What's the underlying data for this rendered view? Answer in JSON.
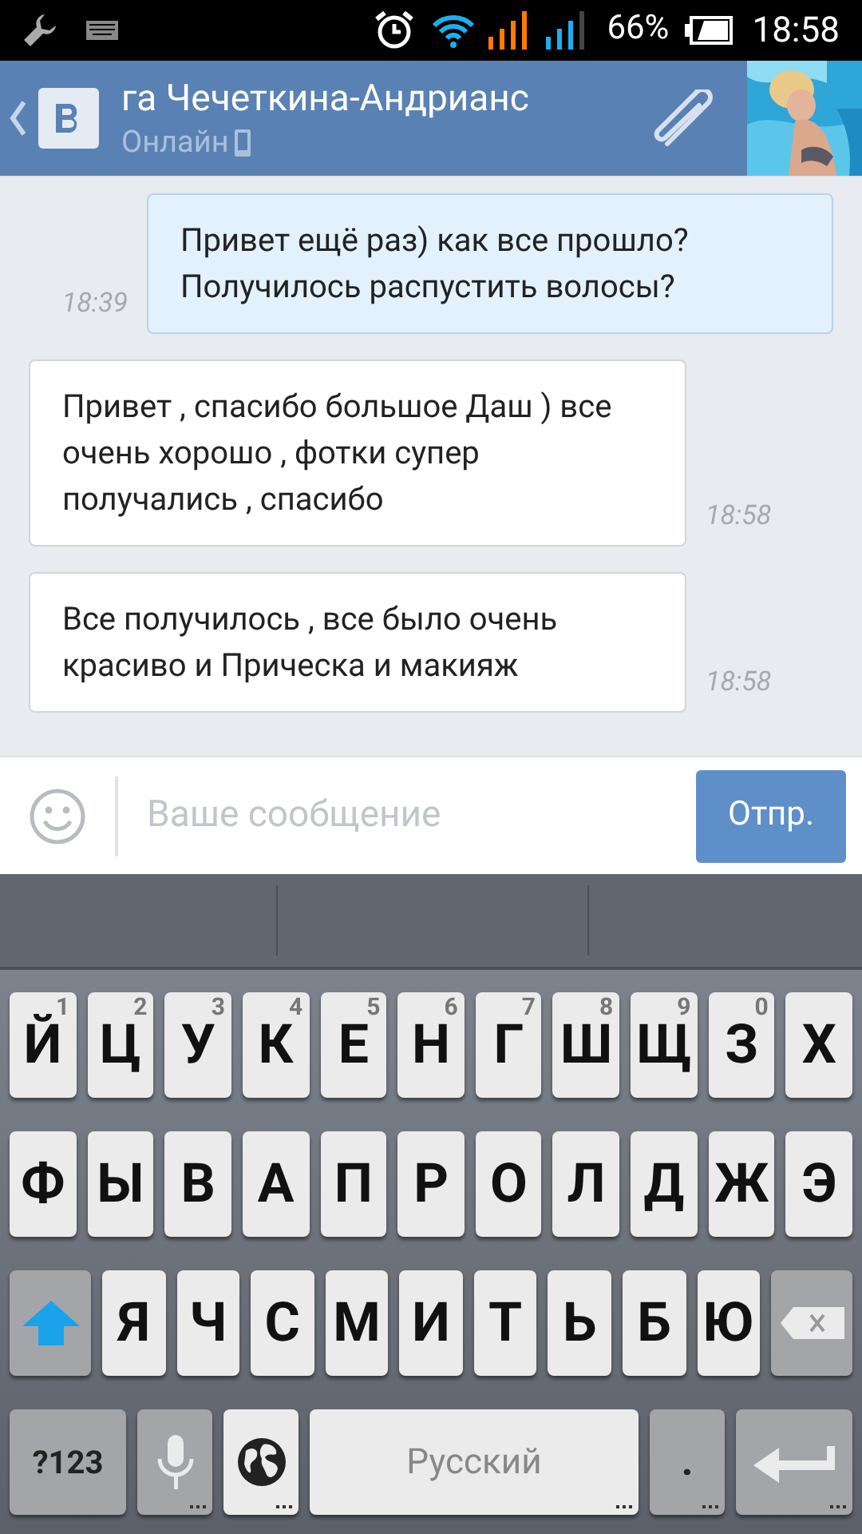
{
  "status_bar": {
    "battery": "66%",
    "time": "18:58"
  },
  "header": {
    "title": "га Чечеткина-Андрианс",
    "status": "Онлайн"
  },
  "messages": [
    {
      "kind": "outgoing",
      "text": "Привет ещё раз) как все прошло? Получилось распустить волосы?",
      "time": "18:39"
    },
    {
      "kind": "incoming",
      "text": "Привет , спасибо большое Даш ) все очень хорошо , фотки супер получались , спасибо",
      "time": "18:58"
    },
    {
      "kind": "incoming",
      "text": "Все получилось , все было очень красиво и Прическа и макияж",
      "time": "18:58"
    }
  ],
  "composer": {
    "placeholder": "Ваше сообщение",
    "send": "Отпр."
  },
  "keyboard": {
    "rows": [
      [
        {
          "kind": "letter",
          "label": "Й",
          "hint": "1"
        },
        {
          "kind": "letter",
          "label": "Ц",
          "hint": "2"
        },
        {
          "kind": "letter",
          "label": "У",
          "hint": "3"
        },
        {
          "kind": "letter",
          "label": "К",
          "hint": "4"
        },
        {
          "kind": "letter",
          "label": "Е",
          "hint": "5"
        },
        {
          "kind": "letter",
          "label": "Н",
          "hint": "6"
        },
        {
          "kind": "letter",
          "label": "Г",
          "hint": "7"
        },
        {
          "kind": "letter",
          "label": "Ш",
          "hint": "8"
        },
        {
          "kind": "letter",
          "label": "Щ",
          "hint": "9"
        },
        {
          "kind": "letter",
          "label": "З",
          "hint": "0"
        },
        {
          "kind": "letter",
          "label": "Х"
        }
      ],
      [
        {
          "kind": "letter",
          "label": "Ф"
        },
        {
          "kind": "letter",
          "label": "Ы"
        },
        {
          "kind": "letter",
          "label": "В"
        },
        {
          "kind": "letter",
          "label": "А"
        },
        {
          "kind": "letter",
          "label": "П"
        },
        {
          "kind": "letter",
          "label": "Р"
        },
        {
          "kind": "letter",
          "label": "О"
        },
        {
          "kind": "letter",
          "label": "Л"
        },
        {
          "kind": "letter",
          "label": "Д"
        },
        {
          "kind": "letter",
          "label": "Ж"
        },
        {
          "kind": "letter",
          "label": "Э"
        }
      ],
      [
        {
          "kind": "shift"
        },
        {
          "kind": "letter",
          "label": "Я"
        },
        {
          "kind": "letter",
          "label": "Ч"
        },
        {
          "kind": "letter",
          "label": "С"
        },
        {
          "kind": "letter",
          "label": "М"
        },
        {
          "kind": "letter",
          "label": "И"
        },
        {
          "kind": "letter",
          "label": "Т"
        },
        {
          "kind": "letter",
          "label": "Ь"
        },
        {
          "kind": "letter",
          "label": "Б"
        },
        {
          "kind": "letter",
          "label": "Ю"
        },
        {
          "kind": "backspace"
        }
      ]
    ],
    "bottom_row": [
      {
        "kind": "symbols",
        "label": "?123"
      },
      {
        "kind": "mic"
      },
      {
        "kind": "globe"
      },
      {
        "kind": "space",
        "label": "Русский"
      },
      {
        "kind": "period",
        "label": "."
      },
      {
        "kind": "enter"
      }
    ]
  }
}
